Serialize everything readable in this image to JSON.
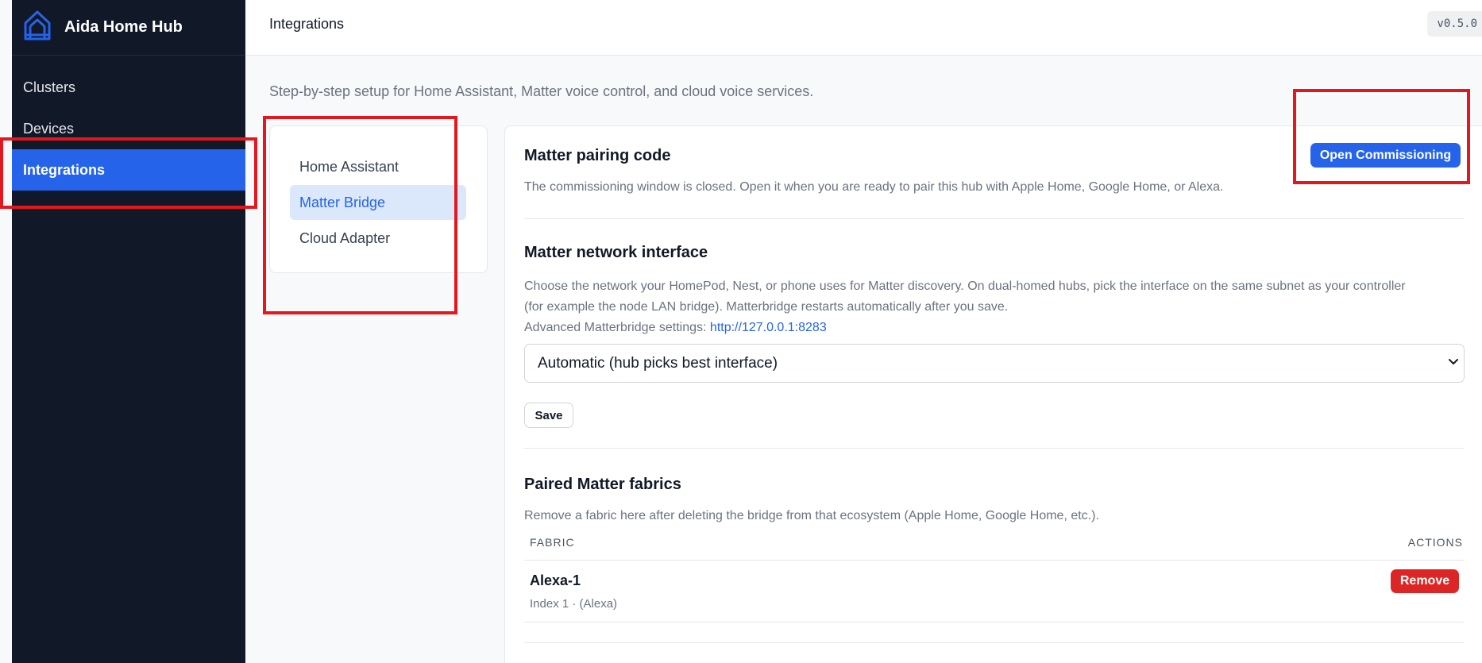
{
  "app": {
    "title": "Aida Home Hub",
    "version": "v0.5.0"
  },
  "sidebar": {
    "items": [
      {
        "label": "Clusters"
      },
      {
        "label": "Devices"
      },
      {
        "label": "Integrations",
        "active": true
      }
    ]
  },
  "header": {
    "title": "Integrations"
  },
  "page": {
    "subtitle": "Step-by-step setup for Home Assistant, Matter voice control, and cloud voice services."
  },
  "subnav": {
    "items": [
      {
        "label": "Home Assistant"
      },
      {
        "label": "Matter Bridge",
        "active": true
      },
      {
        "label": "Cloud Adapter"
      }
    ]
  },
  "pairing": {
    "title": "Matter pairing code",
    "button": "Open Commissioning",
    "description": "The commissioning window is closed. Open it when you are ready to pair this hub with Apple Home, Google Home, or Alexa."
  },
  "network": {
    "title": "Matter network interface",
    "description_line1": "Choose the network your HomePod, Nest, or phone uses for Matter discovery. On dual-homed hubs, pick the interface on the same subnet as your controller",
    "description_line2": "(for example the node LAN bridge). Matterbridge restarts automatically after you save.",
    "advanced_label": "Advanced Matterbridge settings:",
    "advanced_link": "http://127.0.0.1:8283",
    "select_value": "Automatic (hub picks best interface)",
    "save_label": "Save"
  },
  "fabrics": {
    "title": "Paired Matter fabrics",
    "description": "Remove a fabric here after deleting the bridge from that ecosystem (Apple Home, Google Home, etc.).",
    "columns": [
      "FABRIC",
      "ACTIONS"
    ],
    "rows": [
      {
        "name": "Alexa-1",
        "meta": "Index 1 · (Alexa)",
        "action": "Remove"
      }
    ]
  },
  "colors": {
    "sidebar_bg": "#111827",
    "accent": "#2563eb",
    "danger": "#dc2626",
    "highlight": "#e3171d"
  }
}
